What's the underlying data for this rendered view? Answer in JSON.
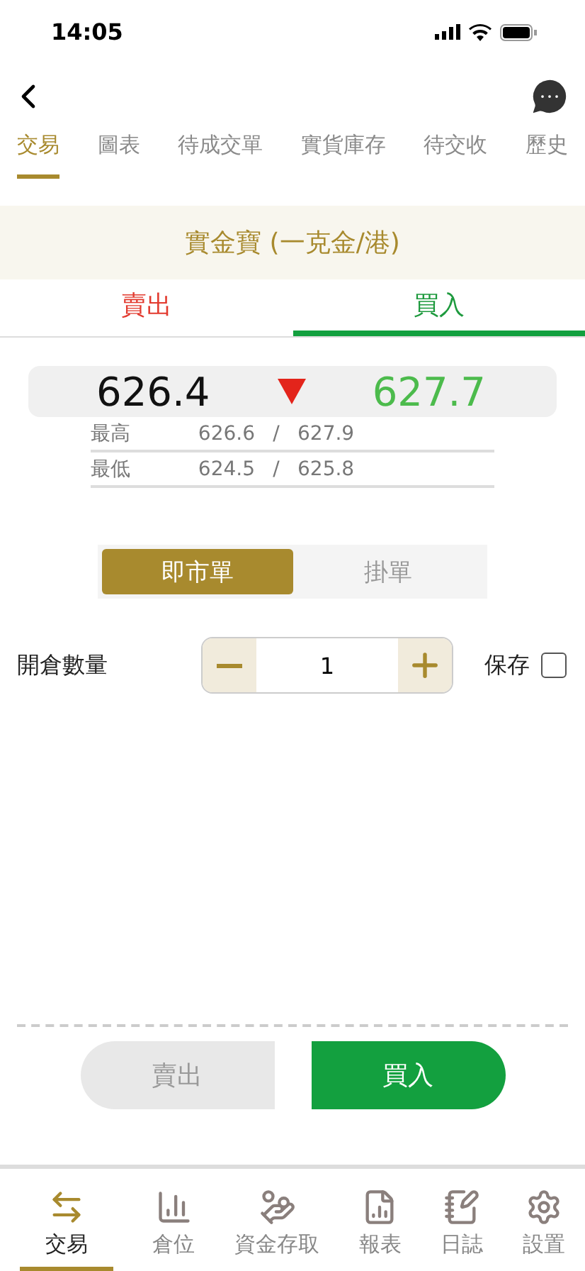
{
  "status_bar": {
    "time": "14:05"
  },
  "tabs": [
    {
      "label": "交易",
      "selected": true
    },
    {
      "label": "圖表",
      "selected": false
    },
    {
      "label": "待成交單",
      "selected": false
    },
    {
      "label": "實貨庫存",
      "selected": false
    },
    {
      "label": "待交收",
      "selected": false
    },
    {
      "label": "歷史",
      "selected": false
    }
  ],
  "product": {
    "title": "實金寶 (一克金/港)"
  },
  "sides": [
    {
      "label": "賣出",
      "kind": "sell",
      "selected": false
    },
    {
      "label": "買入",
      "kind": "buy",
      "selected": true
    }
  ],
  "quote": {
    "bid": "626.4",
    "ask": "627.7",
    "rows": [
      {
        "label": "最高",
        "bid": "626.6",
        "separator": "/",
        "ask": "627.9"
      },
      {
        "label": "最低",
        "bid": "624.5",
        "separator": "/",
        "ask": "625.8"
      }
    ]
  },
  "order_types": [
    {
      "label": "即市單",
      "selected": true
    },
    {
      "label": "掛單",
      "selected": false
    }
  ],
  "quantity": {
    "label": "開倉數量",
    "value": "1"
  },
  "save": {
    "label": "保存",
    "checked": false
  },
  "actions": [
    {
      "label": "賣出",
      "kind": "sell",
      "disabled": true
    },
    {
      "label": "買入",
      "kind": "buy",
      "disabled": false
    }
  ],
  "bottom_nav": [
    {
      "label": "交易",
      "selected": true
    },
    {
      "label": "倉位",
      "selected": false
    },
    {
      "label": "資金存取",
      "selected": false
    },
    {
      "label": "報表",
      "selected": false
    },
    {
      "label": "日誌",
      "selected": false
    },
    {
      "label": "設置",
      "selected": false
    }
  ]
}
